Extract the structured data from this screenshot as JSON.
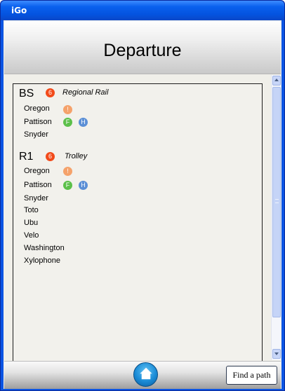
{
  "window": {
    "title": "iGo"
  },
  "header": {
    "title": "Departure"
  },
  "routes": [
    {
      "name": "BS",
      "badge": "6",
      "type": "Regional Rail",
      "stops": [
        {
          "name": "Oregon",
          "chips": [
            {
              "label": "!",
              "color": "#f5a26b"
            }
          ]
        },
        {
          "name": "Pattison",
          "chips": [
            {
              "label": "F",
              "color": "#5cc04a"
            },
            {
              "label": "H",
              "color": "#5b8fd6"
            }
          ]
        },
        {
          "name": "Snyder",
          "chips": []
        }
      ]
    },
    {
      "name": "R1",
      "badge": "6",
      "type": "Trolley",
      "stops": [
        {
          "name": "Oregon",
          "chips": [
            {
              "label": "!",
              "color": "#f5a26b"
            }
          ]
        },
        {
          "name": "Pattison",
          "chips": [
            {
              "label": "F",
              "color": "#5cc04a"
            },
            {
              "label": "H",
              "color": "#5b8fd6"
            }
          ]
        },
        {
          "name": "Snyder",
          "chips": []
        },
        {
          "name": "Toto",
          "chips": []
        },
        {
          "name": "Ubu",
          "chips": []
        },
        {
          "name": "Velo",
          "chips": []
        },
        {
          "name": "Washington",
          "chips": []
        },
        {
          "name": "Xylophone",
          "chips": []
        }
      ]
    }
  ],
  "footer": {
    "home_icon": "home-icon",
    "find_path_label": "Find a path"
  },
  "colors": {
    "titlebar": "#0a54e3",
    "route_badge": "#f24a1a"
  }
}
